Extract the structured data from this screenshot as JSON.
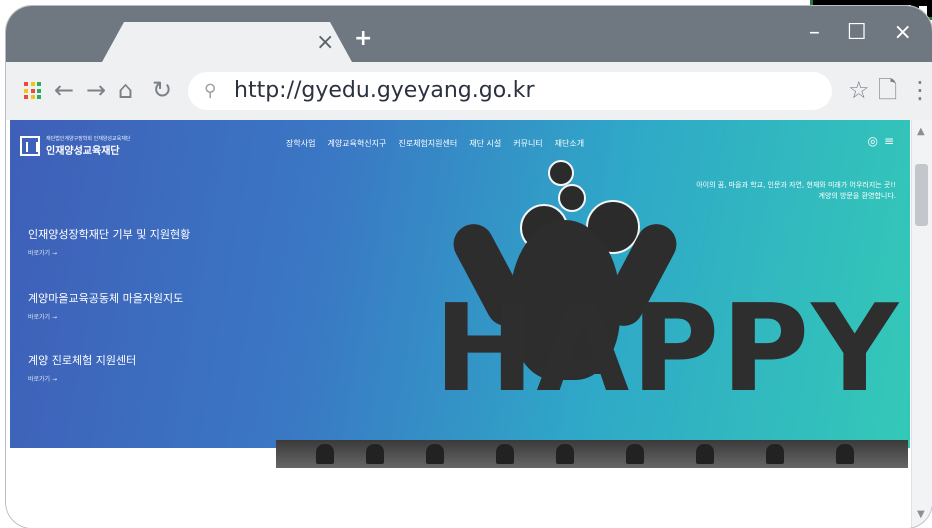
{
  "browser": {
    "tab_close": "×",
    "new_tab": "+",
    "window_controls": "– ☐ ×",
    "url": "http://gyedu.gyeyang.go.kr",
    "icons": [
      "apps-icon",
      "back-icon",
      "forward-icon",
      "home-icon",
      "reload-icon",
      "search-icon",
      "star-icon",
      "page-icon",
      "more-icon"
    ]
  },
  "site": {
    "logo_subtitle": "재단법인계양구장학회 인재양성교육재단",
    "logo_name": "인재양성교육재단",
    "nav": [
      "장학사업",
      "계양교육혁신지구",
      "진로체험지원센터",
      "재단 시설",
      "커뮤니티",
      "재단소개"
    ],
    "tagline_line1": "아이의 꿈, 마을과 학교, 인문과 자연, 현재와 미래가 어우러지는 곳!!",
    "tagline_line2": "계양의 방문을 환영합니다.",
    "menu": [
      {
        "title": "인재양성장학재단 기부 및 지원현황",
        "link": "바로가기 →"
      },
      {
        "title": "계양마을교육공동체 마을자원지도",
        "link": "바로가기 →"
      },
      {
        "title": "계양 진로체험 지원센터",
        "link": "바로가기 →"
      }
    ],
    "happy_text": "HAPPY"
  },
  "colors": {
    "chrome": "#6f7780",
    "toolbar": "#eef0f2",
    "hero_left": "#3f5fb8",
    "hero_right": "#34c9b7"
  }
}
